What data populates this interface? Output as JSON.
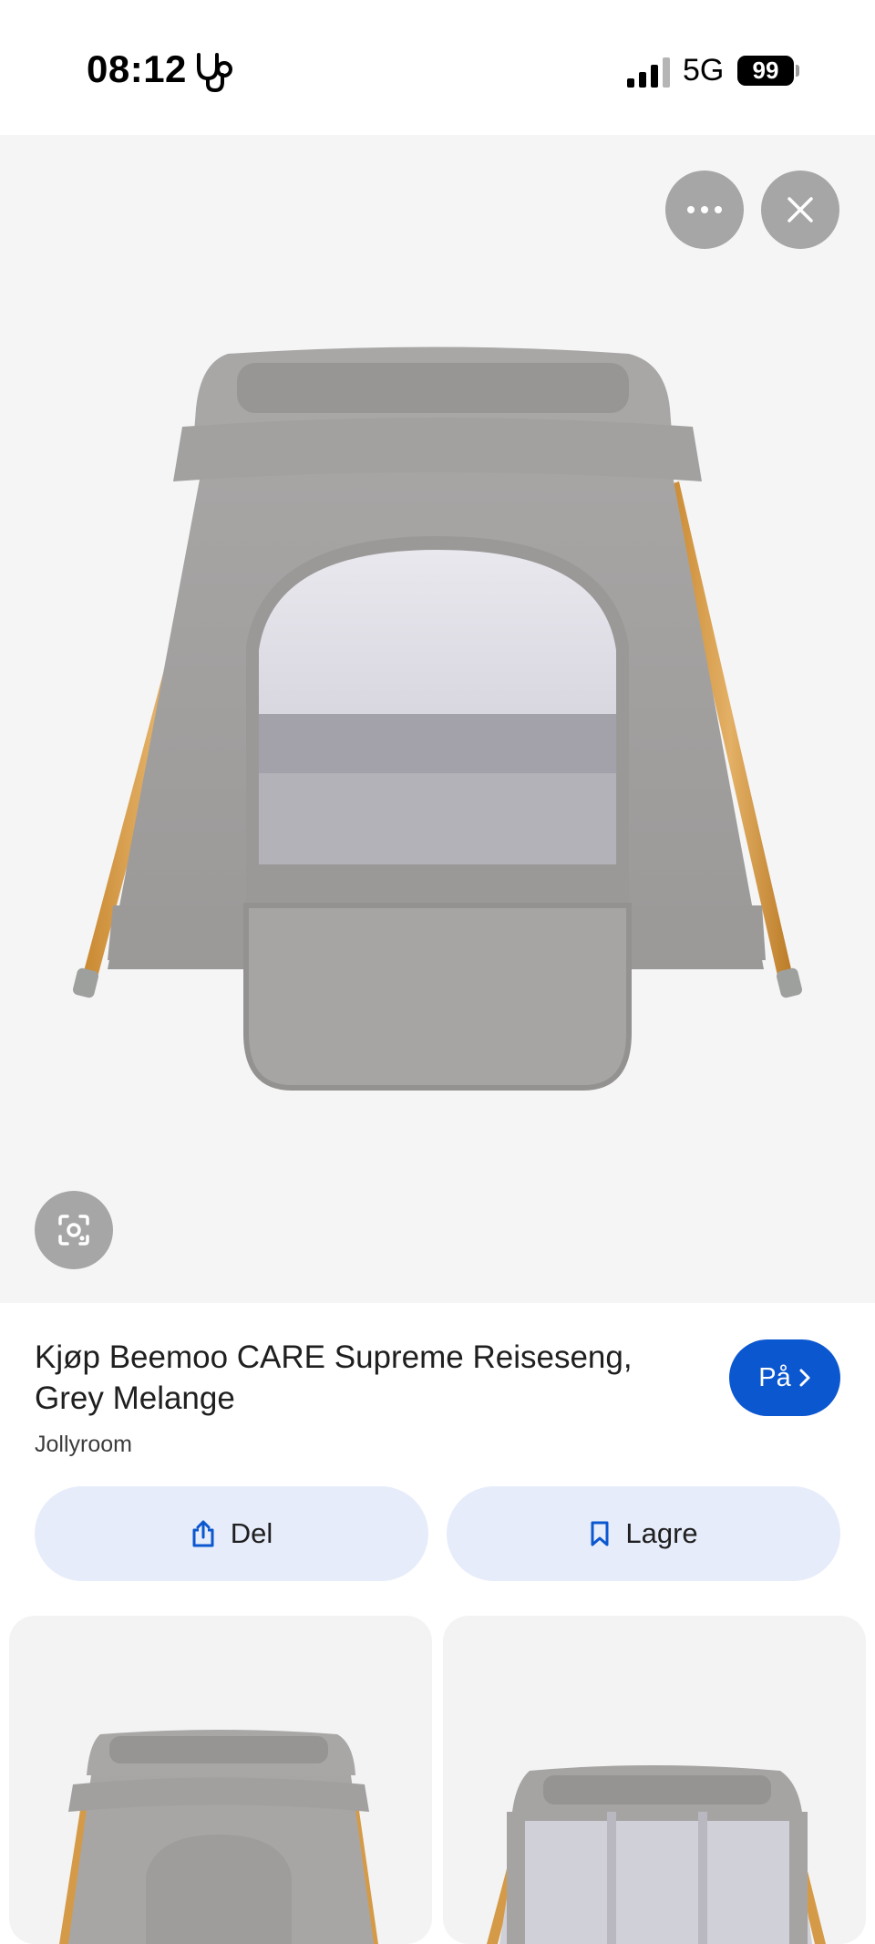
{
  "status_bar": {
    "time": "08:12",
    "network": "5G",
    "battery": "99"
  },
  "hero": {
    "more_icon": "more-horizontal-icon",
    "close_icon": "close-icon",
    "lens_icon": "lens-search-icon"
  },
  "product": {
    "title": "Kjøp Beemoo CARE Supreme Reiseseng, Grey Melange",
    "source": "Jollyroom",
    "visit_label": "På"
  },
  "actions": {
    "share_label": "Del",
    "save_label": "Lagre"
  },
  "colors": {
    "accent": "#0b57d0",
    "action_bg": "#e6ecfa",
    "image_bg": "#f5f5f5"
  }
}
